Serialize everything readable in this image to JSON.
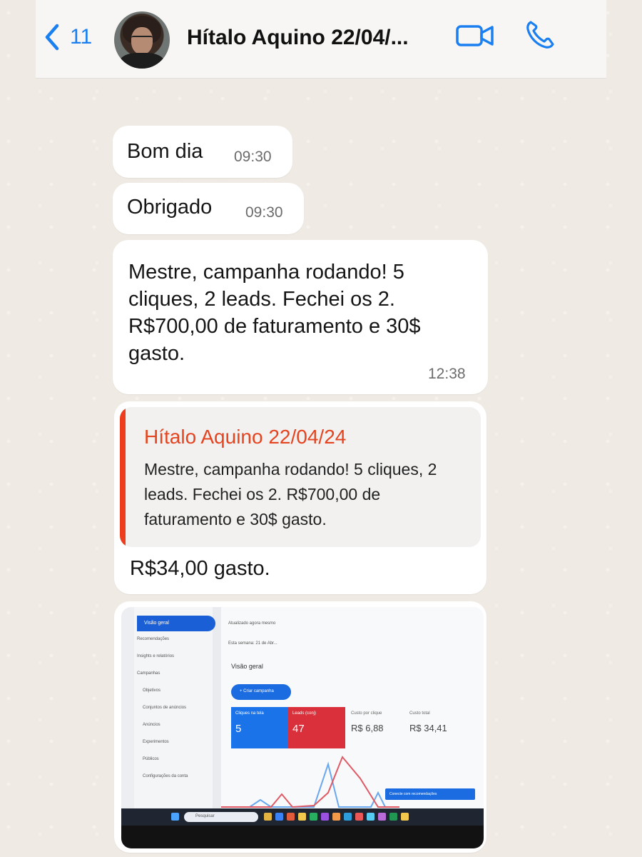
{
  "header": {
    "back_count": "11",
    "contact_name": "Hítalo Aquino 22/04/..."
  },
  "messages": [
    {
      "text": "Bom dia",
      "time": "09:30"
    },
    {
      "text": "Obrigado",
      "time": "09:30"
    },
    {
      "text": "Mestre, campanha rodando! 5 cliques, 2 leads. Fechei os 2. R$700,00 de faturamento e 30$ gasto.",
      "time": "12:38"
    }
  ],
  "reply": {
    "quoted_author": "Hítalo Aquino 22/04/24",
    "quoted_text": "Mestre, campanha rodando! 5 cliques, 2 leads. Fechei os 2. R$700,00 de faturamento e 30$ gasto.",
    "text": "R$34,00 gasto."
  },
  "photo": {
    "nav": [
      "Visão geral",
      "Recomendações",
      "Insights e relatórios",
      "Campanhas",
      "Objetivos",
      "Conjuntos de anúncios",
      "Anúncios",
      "Experimentos",
      "Públicos",
      "Configurações da conta"
    ],
    "top_selector": "Atualizado agora mesmo",
    "date_range": "Esta semana: 21 de Abr...",
    "page_title": "Visão geral",
    "create_button": "+ Criar campanha",
    "cards": [
      {
        "label": "Cliques na tela",
        "value": "5"
      },
      {
        "label": "Leads (conj)",
        "value": "47"
      },
      {
        "label": "Custo por clique",
        "value": "R$ 6,88"
      },
      {
        "label": "Custo total",
        "value": "R$ 34,41"
      }
    ],
    "toast": "Conecte com recomendações",
    "taskbar_search": "Pesquisar"
  },
  "colors": {
    "accent_blue": "#1a7ff0",
    "quote_red": "#e4441f",
    "bubble": "#ffffff"
  }
}
